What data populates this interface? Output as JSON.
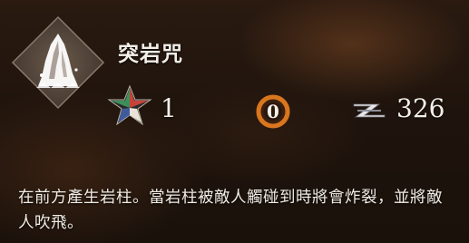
{
  "skill": {
    "name": "突岩咒",
    "icon": "rock-spire-icon",
    "description": "在前方產生岩柱。當岩柱被敵人觸碰到時將會炸裂，並將敵人吹飛。"
  },
  "stats": {
    "star": {
      "icon": "tricolor-star-icon",
      "value": "1"
    },
    "ring": {
      "icon": "orange-ring-icon",
      "value": "0"
    },
    "z": {
      "icon": "z-emblem-icon",
      "value": "326"
    }
  },
  "colors": {
    "text": "#f1ece4",
    "ring_orange": "#d9761e",
    "star_red": "#c8423a",
    "star_green": "#3d8f5b",
    "star_blue": "#3f5d9e"
  }
}
